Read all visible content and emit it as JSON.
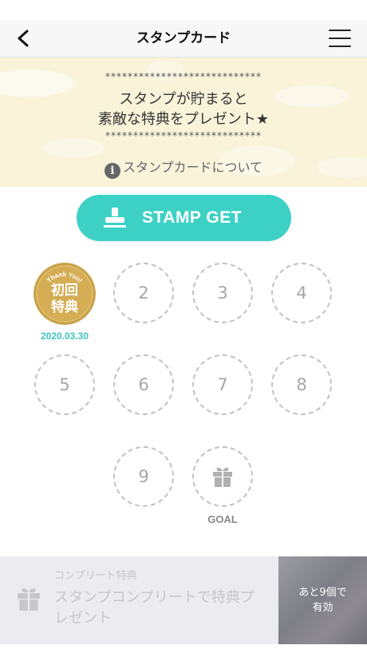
{
  "header": {
    "title": "スタンプカード",
    "back_icon": "chevron-left-icon",
    "menu_icon": "hamburger-menu-icon"
  },
  "banner": {
    "stars": "****************************",
    "message_line1": "スタンプが貯まると",
    "message_line2": "素敵な特典をプレゼント★",
    "about_link": "スタンプカードについて",
    "info_icon": "info-icon"
  },
  "stamp_button": {
    "label": "STAMP GET",
    "icon": "stamp-icon",
    "color": "#3dd1c6"
  },
  "stamps": {
    "first": {
      "arc_text": "Thank You!",
      "line1": "初回",
      "line2": "特典",
      "date": "2020.03.30"
    },
    "empty_slots": [
      "2",
      "3",
      "4",
      "5",
      "6",
      "7",
      "8",
      "9"
    ],
    "goal_label": "GOAL",
    "goal_icon": "gift-icon",
    "accent_color": "#3ec4bb",
    "gold_color": "#c9a24a"
  },
  "reward": {
    "caption": "コンプリート特典",
    "message_line1": "スタンプコンプリートで特典プ",
    "message_line2": "レゼント",
    "remaining_line1": "あと9個で",
    "remaining_line2": "有効",
    "icon": "gift-icon"
  }
}
